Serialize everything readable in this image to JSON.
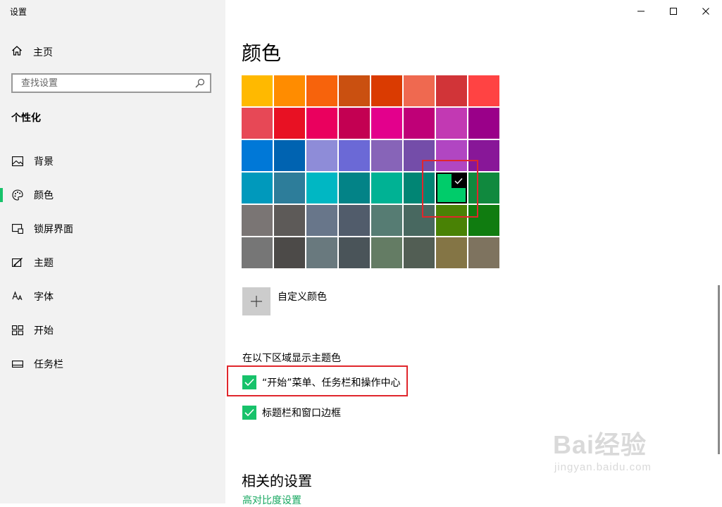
{
  "app": {
    "title": "设置"
  },
  "sidebar": {
    "home_label": "主页",
    "search_placeholder": "查找设置",
    "section_title": "个性化",
    "items": [
      {
        "label": "背景",
        "icon": "picture-icon",
        "active": false
      },
      {
        "label": "颜色",
        "icon": "palette-icon",
        "active": true
      },
      {
        "label": "锁屏界面",
        "icon": "lock-screen-icon",
        "active": false
      },
      {
        "label": "主题",
        "icon": "theme-brush-icon",
        "active": false
      },
      {
        "label": "字体",
        "icon": "font-icon",
        "active": false
      },
      {
        "label": "开始",
        "icon": "start-icon",
        "active": false
      },
      {
        "label": "任务栏",
        "icon": "taskbar-icon",
        "active": false
      }
    ]
  },
  "window_controls": [
    "minimize-icon",
    "maximize-icon",
    "close-icon"
  ],
  "main": {
    "title": "颜色",
    "color_grid": [
      [
        "#FFB900",
        "#FF8C00",
        "#F7630C",
        "#CA5010",
        "#DA3B01",
        "#EF6950",
        "#D13438",
        "#FF4343"
      ],
      [
        "#E74856",
        "#E81123",
        "#EA005E",
        "#C30052",
        "#E3008C",
        "#BF0077",
        "#C239B3",
        "#9A0089"
      ],
      [
        "#0078D7",
        "#0063B1",
        "#8E8CD8",
        "#6B69D6",
        "#8764B8",
        "#744DA9",
        "#B146C2",
        "#881798"
      ],
      [
        "#0099BC",
        "#2D7D9A",
        "#00B7C3",
        "#038387",
        "#00B294",
        "#018574",
        "#00CC6A",
        "#10893E"
      ],
      [
        "#7A7574",
        "#5D5A58",
        "#68768A",
        "#515C6B",
        "#567C73",
        "#486860",
        "#498205",
        "#107C10"
      ],
      [
        "#767676",
        "#4C4A48",
        "#69797E",
        "#4A5459",
        "#647C64",
        "#525E54",
        "#847545",
        "#7E735F"
      ]
    ],
    "selected_color": {
      "row": 3,
      "col": 6
    },
    "custom_color_label": "自定义颜色",
    "accent_surfaces_heading": "在以下区域显示主题色",
    "checkboxes": [
      {
        "label": "“开始”菜单、任务栏和操作中心",
        "checked": true
      },
      {
        "label": "标题栏和窗口边框",
        "checked": true
      }
    ],
    "related_title": "相关的设置",
    "related_link": "高对比度设置"
  },
  "accent_color": "#17C26A",
  "highlight_color": "#E0262C",
  "watermark": {
    "main": "Bai经验",
    "sub": "jingyan.baidu.com"
  }
}
